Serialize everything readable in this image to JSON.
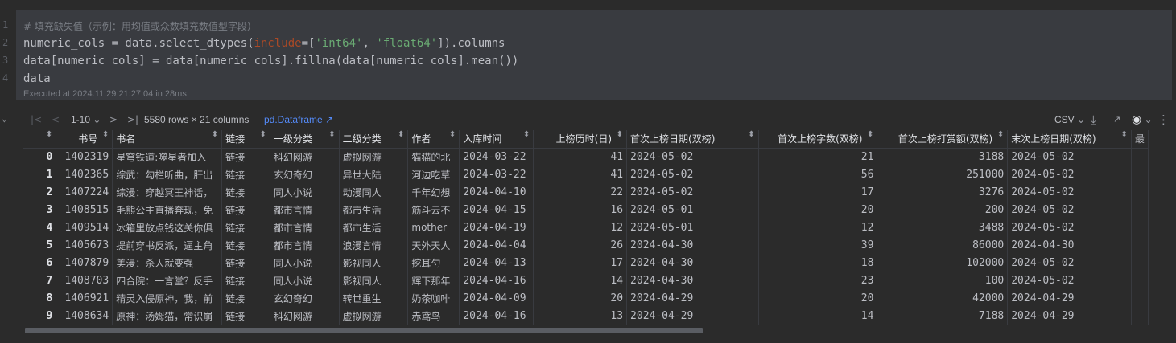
{
  "editor": {
    "line_numbers": [
      "1",
      "2",
      "3",
      "4"
    ],
    "lines": [
      [
        {
          "t": "# 填充缺失值（示例：用均值或众数填充数值型字段）",
          "c": "c-comment"
        }
      ],
      [
        {
          "t": "numeric_cols = data.select_dtypes(",
          "c": "c-fn"
        },
        {
          "t": "include",
          "c": "c-kw"
        },
        {
          "t": "=[",
          "c": "c-fn"
        },
        {
          "t": "'int64'",
          "c": "c-str"
        },
        {
          "t": ", ",
          "c": "c-fn"
        },
        {
          "t": "'float64'",
          "c": "c-str"
        },
        {
          "t": "]).columns",
          "c": "c-fn"
        }
      ],
      [
        {
          "t": "data[numeric_cols] = data[numeric_cols].fillna(data[numeric_cols].mean())",
          "c": "c-fn"
        }
      ],
      [
        {
          "t": "data",
          "c": "c-fn"
        }
      ]
    ],
    "exec_info": "Executed at 2024.11.29 21:27:04 in 28ms"
  },
  "toolbar": {
    "first_icon": "|<",
    "prev_icon": "<",
    "page_range": "1-10",
    "page_range_caret": "⌄",
    "next_icon": ">",
    "last_icon": ">|",
    "summary": "5580 rows × 21 columns",
    "df_link": "pd.Dataframe ↗",
    "csv_label": "CSV",
    "csv_caret": "⌄",
    "download_icon": "⤓",
    "open_icon": "↗",
    "eye_icon": "◉",
    "eye_caret": "⌄",
    "more_icon": "⋮",
    "collapse_icon": "⌄"
  },
  "table": {
    "columns": [
      "",
      "书号",
      "书名",
      "链接",
      "一级分类",
      "二级分类",
      "作者",
      "入库时间",
      "上榜历时(日)",
      "首次上榜日期(双榜)",
      "首次上榜字数(双榜)",
      "首次上榜打赏额(双榜)",
      "末次上榜日期(双榜)",
      "最"
    ],
    "sort_icon": "⬍",
    "rows": [
      [
        "0",
        "1402319",
        "星穹铁道:噬星者加入",
        "链接",
        "科幻网游",
        "虚拟网游",
        "猫猫的北",
        "2024-03-22",
        "41",
        "2024-05-02",
        "21",
        "3188",
        "2024-05-02"
      ],
      [
        "1",
        "1402365",
        "综武：勾栏听曲，肝出",
        "链接",
        "玄幻奇幻",
        "异世大陆",
        "河边吃草",
        "2024-03-22",
        "41",
        "2024-05-02",
        "56",
        "251000",
        "2024-05-02"
      ],
      [
        "2",
        "1407224",
        "综漫：穿越冥王神话，",
        "链接",
        "同人小说",
        "动漫同人",
        "千年幻想",
        "2024-04-10",
        "22",
        "2024-05-02",
        "17",
        "3276",
        "2024-05-02"
      ],
      [
        "3",
        "1408515",
        "毛熊公主直播奔现，免",
        "链接",
        "都市言情",
        "都市生活",
        "筋斗云不",
        "2024-04-15",
        "16",
        "2024-05-01",
        "20",
        "200",
        "2024-05-02"
      ],
      [
        "4",
        "1409514",
        "冰箱里放点钱这关你俱",
        "链接",
        "都市言情",
        "都市生活",
        "mother",
        "2024-04-19",
        "12",
        "2024-05-01",
        "12",
        "3488",
        "2024-05-02"
      ],
      [
        "5",
        "1405673",
        "提前穿书反派，逼主角",
        "链接",
        "都市言情",
        "浪漫言情",
        "天外天人",
        "2024-04-04",
        "26",
        "2024-04-30",
        "39",
        "86000",
        "2024-04-30"
      ],
      [
        "6",
        "1407879",
        "美漫：杀人就变强",
        "链接",
        "同人小说",
        "影视同人",
        "挖耳勺",
        "2024-04-13",
        "17",
        "2024-04-30",
        "18",
        "102000",
        "2024-05-02"
      ],
      [
        "7",
        "1408703",
        "四合院：一言堂？反手",
        "链接",
        "同人小说",
        "影视同人",
        "辉下那年",
        "2024-04-16",
        "14",
        "2024-04-30",
        "23",
        "100",
        "2024-05-02"
      ],
      [
        "8",
        "1406921",
        "精灵入侵原神，我，前",
        "链接",
        "玄幻奇幻",
        "转世重生",
        "奶茶咖啡",
        "2024-04-09",
        "20",
        "2024-04-29",
        "20",
        "42000",
        "2024-04-29"
      ],
      [
        "9",
        "1408634",
        "原神：汤姆猫，常识崩",
        "链接",
        "科幻网游",
        "虚拟网游",
        "赤鸢鸟",
        "2024-04-16",
        "13",
        "2024-04-29",
        "14",
        "7188",
        "2024-04-29"
      ]
    ]
  }
}
